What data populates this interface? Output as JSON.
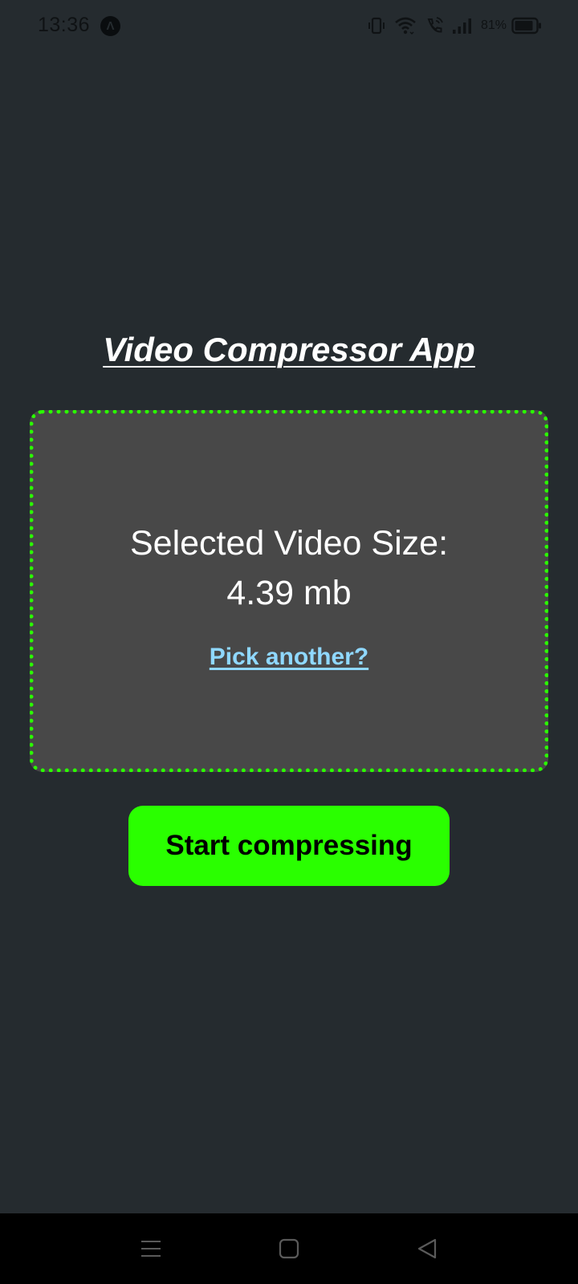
{
  "status_bar": {
    "time": "13:36",
    "app_icon_glyph": "Λ",
    "battery_percent": "81%",
    "icons": [
      "vibrate-icon",
      "wifi-icon",
      "wifi-call-icon",
      "signal-icon",
      "battery-icon"
    ]
  },
  "main": {
    "title": "Video Compressor App",
    "card": {
      "size_label": "Selected Video Size:",
      "size_value": "4.39 mb",
      "pick_link": "Pick another?"
    },
    "start_button": "Start compressing"
  },
  "nav_bar": {
    "icons": [
      "menu-icon",
      "home-icon",
      "back-icon"
    ]
  },
  "colors": {
    "background": "#252b2f",
    "card_background": "#484848",
    "accent_green": "#2aff00",
    "link_blue": "#8fd8ff",
    "nav_background": "#000000"
  }
}
